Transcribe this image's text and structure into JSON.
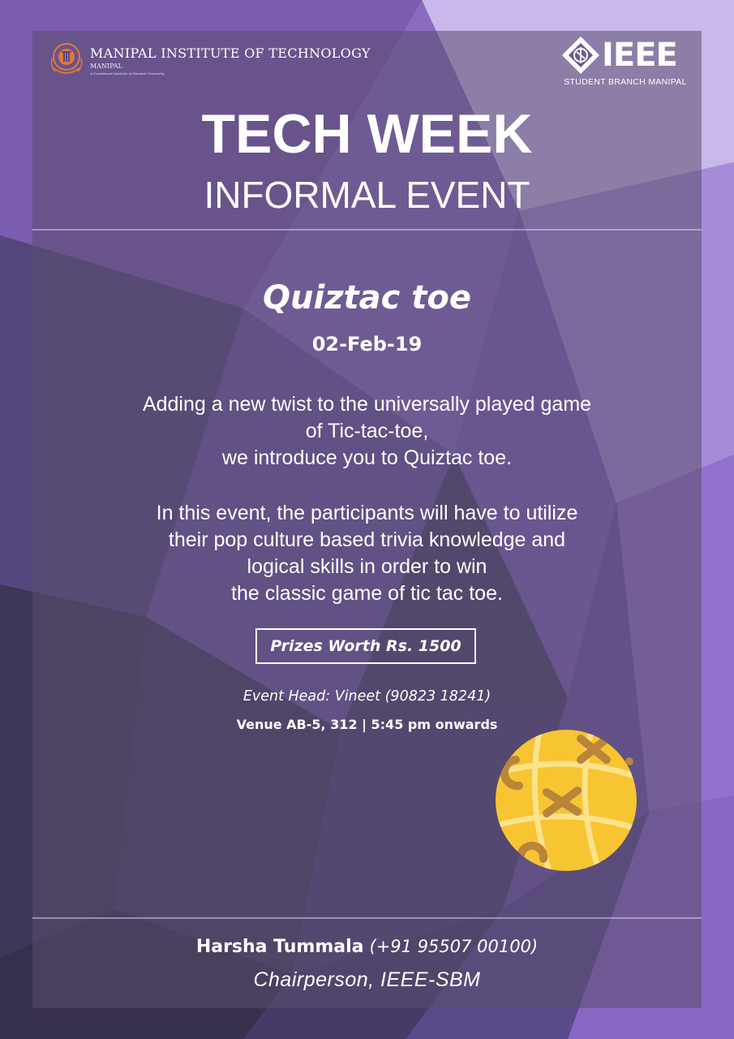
{
  "header": {
    "institute_name": "MANIPAL INSTITUTE OF TECHNOLOGY",
    "institute_location": "MANIPAL",
    "institute_tagline": "A Constituent Institute of Manipal University",
    "ieee_word": "IEEE",
    "ieee_branch": "STUDENT BRANCH MANIPAL"
  },
  "title": "TECH WEEK",
  "subtitle": "INFORMAL EVENT",
  "event": {
    "name": "Quiztac toe",
    "date": "02-Feb-19",
    "description_1": [
      "Adding a new twist to the universally played game",
      "of Tic-tac-toe,",
      "we introduce you to Quiztac toe."
    ],
    "description_2": [
      "In this event, the participants will have to  utilize",
      "their pop culture based trivia knowledge and",
      "logical skills in order to win",
      "the classic game of tic tac toe."
    ],
    "prize": "Prizes Worth Rs. 1500",
    "event_head": "Event Head: Vineet (90823 18241)",
    "venue": "Venue AB-5, 312 | 5:45 pm onwards"
  },
  "footer": {
    "chair_name": "Harsha Tummala",
    "chair_phone": "(+91 95507 00100)",
    "chair_role": "Chairperson, IEEE-SBM"
  },
  "icons": [
    "mit-emblem-icon",
    "ieee-diamond-icon",
    "tic-tac-toe-ball-icon"
  ],
  "colors": {
    "background": "#5a4a82",
    "accent_purple": "#8e6cc8",
    "emblem_orange": "#e0783a",
    "ball_yellow": "#f7c531",
    "ball_marks": "#b9853a"
  }
}
